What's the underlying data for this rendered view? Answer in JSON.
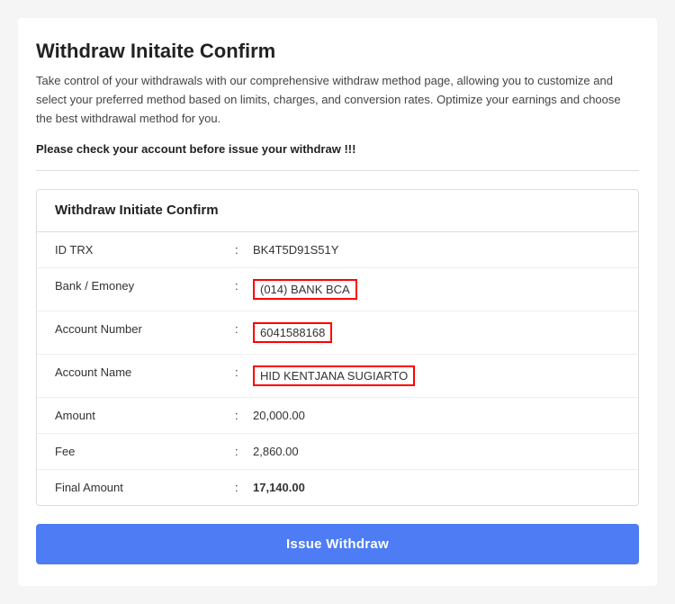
{
  "page": {
    "title": "Withdraw Initaite Confirm",
    "description": "Take control of your withdrawals with our comprehensive withdraw method page, allowing you to customize and select your preferred method based on limits, charges, and conversion rates. Optimize your earnings and choose the best withdrawal method for you.",
    "warning": "Please check your account before issue your withdraw !!!"
  },
  "card": {
    "title": "Withdraw Initiate Confirm",
    "rows": [
      {
        "label": "ID TRX",
        "value": "BK4T5D91S51Y",
        "highlight": false,
        "bold": false
      },
      {
        "label": "Bank / Emoney",
        "value": "(014) BANK BCA",
        "highlight": true,
        "bold": false
      },
      {
        "label": "Account Number",
        "value": "6041588168",
        "highlight": true,
        "bold": false
      },
      {
        "label": "Account Name",
        "value": "HID KENTJANA SUGIARTO",
        "highlight": true,
        "bold": false
      },
      {
        "label": "Amount",
        "value": "20,000.00",
        "highlight": false,
        "bold": false
      },
      {
        "label": "Fee",
        "value": "2,860.00",
        "highlight": false,
        "bold": false
      },
      {
        "label": "Final Amount",
        "value": "17,140.00",
        "highlight": false,
        "bold": true
      }
    ],
    "button_label": "Issue Withdraw"
  },
  "colors": {
    "accent": "#4d7cf4",
    "highlight_border": "red"
  }
}
